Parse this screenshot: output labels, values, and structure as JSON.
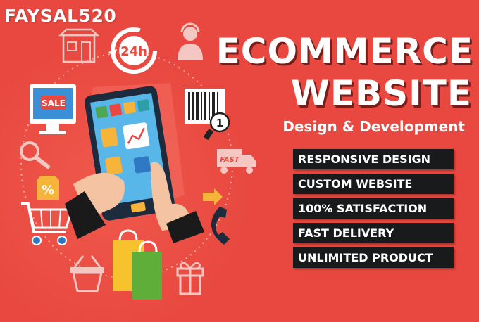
{
  "brand": "FAYSAL520",
  "headline": {
    "line1": "ECOMMERCE",
    "line2": "WEBSITE",
    "subtitle": "Design & Development"
  },
  "features": [
    "RESPONSIVE DESIGN",
    "CUSTOM WEBSITE",
    "100% SATISFACTION",
    "FAST DELIVERY",
    "UNLIMITED PRODUCT"
  ],
  "illustration": {
    "clock_label": "24h",
    "sale_label": "SALE",
    "truck_label": "FAST",
    "percent_label": "%",
    "barcode_number": "1",
    "icons": [
      "store-icon",
      "clock-24h-icon",
      "support-agent-icon",
      "monitor-sale-icon",
      "barcode-scanner-icon",
      "magnifier-icon",
      "delivery-truck-icon",
      "percent-tag-icon",
      "shopping-cart-icon",
      "tablet-shop-icon",
      "phone-icon",
      "basket-icon",
      "shopping-bags-icon",
      "gift-icon"
    ]
  },
  "colors": {
    "background": "#e8483f",
    "bar": "#191a1c",
    "text": "#ffffff",
    "shadow": "#7a1d18"
  }
}
